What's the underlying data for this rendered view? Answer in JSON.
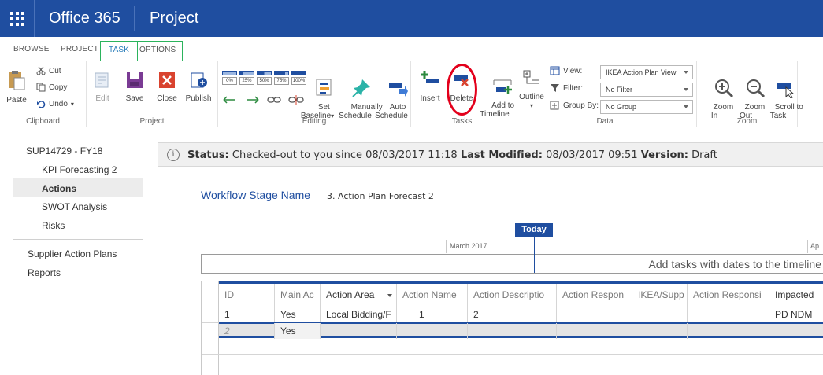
{
  "suite": {
    "brand": "Office 365",
    "app": "Project"
  },
  "tabs": [
    "BROWSE",
    "PROJECT",
    "TASK",
    "OPTIONS"
  ],
  "ribbon": {
    "clipboard": {
      "label": "Clipboard",
      "paste": "Paste",
      "cut": "Cut",
      "copy": "Copy",
      "undo": "Undo"
    },
    "project": {
      "label": "Project",
      "edit": "Edit",
      "save": "Save",
      "close": "Close",
      "publish": "Publish"
    },
    "editing": {
      "label": "Editing",
      "percents": [
        "0%",
        "25%",
        "50%",
        "75%",
        "100%"
      ],
      "set_baseline": "Set\nBaseline",
      "manually_schedule": "Manually\nSchedule",
      "auto_schedule": "Auto\nSchedule"
    },
    "tasks": {
      "label": "Tasks",
      "insert": "Insert",
      "delete": "Delete",
      "add_to_timeline": "Add to\nTimeline"
    },
    "data": {
      "label": "Data",
      "outline": "Outline",
      "view_label": "View:",
      "filter_label": "Filter:",
      "groupby_label": "Group By:",
      "view_value": "IKEA Action Plan View",
      "filter_value": "No Filter",
      "groupby_value": "No Group"
    },
    "zoom": {
      "label": "Zoom",
      "zoom_in": "Zoom\nIn",
      "zoom_out": "Zoom\nOut",
      "scroll_to_task": "Scroll to\nTask"
    }
  },
  "leftnav": {
    "project": "SUP14729 - FY18",
    "items": [
      "KPI Forecasting 2",
      "Actions",
      "SWOT Analysis",
      "Risks"
    ],
    "links": [
      "Supplier Action Plans",
      "Reports"
    ]
  },
  "status": {
    "status_label": "Status:",
    "status_value": "Checked-out to you since 08/03/2017 11:18",
    "modified_label": "Last Modified:",
    "modified_value": "08/03/2017 09:51",
    "version_label": "Version:",
    "version_value": "Draft"
  },
  "workflow": {
    "label": "Workflow Stage Name",
    "value": "3. Action Plan Forecast 2"
  },
  "timeline": {
    "today": "Today",
    "months": [
      "March 2017",
      "Ap"
    ],
    "message": "Add tasks with dates to the timeline"
  },
  "grid": {
    "headers": [
      "ID",
      "Main Ac",
      "Action Area",
      "Action Name",
      "Action Descriptio",
      "Action Respon",
      "IKEA/Supp",
      "Action Responsi",
      "Impacted"
    ],
    "rows": [
      [
        "1",
        "Yes",
        "Local Bidding/F",
        "1",
        "2",
        "",
        "",
        "",
        "PD NDM"
      ],
      [
        "2",
        "Yes",
        "",
        "",
        "",
        "",
        "",
        "",
        ""
      ]
    ]
  }
}
